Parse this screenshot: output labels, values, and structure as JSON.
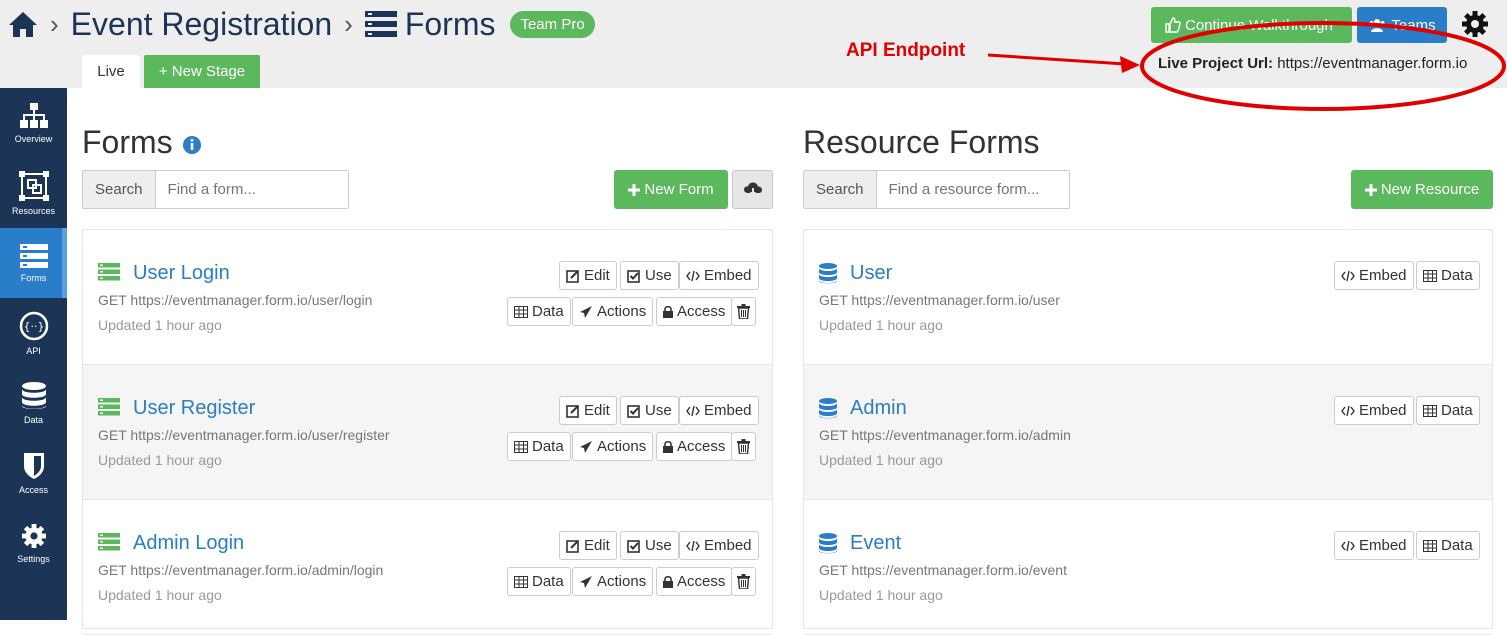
{
  "breadcrumb": {
    "project": "Event Registration",
    "section": "Forms",
    "badge": "Team Pro"
  },
  "stages": {
    "live": "Live",
    "new_stage": "+ New Stage"
  },
  "header_buttons": {
    "walkthrough": "Continue Walkthrough",
    "teams": "Teams"
  },
  "annotation": {
    "label": "API Endpoint",
    "color": "#e00000"
  },
  "live_url": {
    "label": "Live Project Url:",
    "value": "https://eventmanager.form.io"
  },
  "sidebar": {
    "items": [
      {
        "label": "Overview",
        "icon": "sitemap-icon"
      },
      {
        "label": "Resources",
        "icon": "resources-icon"
      },
      {
        "label": "Forms",
        "icon": "forms-icon",
        "active": true
      },
      {
        "label": "API",
        "icon": "api-icon"
      },
      {
        "label": "Data",
        "icon": "database-icon"
      },
      {
        "label": "Access",
        "icon": "shield-icon"
      },
      {
        "label": "Settings",
        "icon": "gear-icon"
      }
    ]
  },
  "forms": {
    "title": "Forms",
    "search_label": "Search",
    "search_placeholder": "Find a form...",
    "new_button": "New Form",
    "items": [
      {
        "name": "User Login",
        "url": "GET https://eventmanager.form.io/user/login",
        "updated": "Updated 1 hour ago"
      },
      {
        "name": "User Register",
        "url": "GET https://eventmanager.form.io/user/register",
        "updated": "Updated 1 hour ago"
      },
      {
        "name": "Admin Login",
        "url": "GET https://eventmanager.form.io/admin/login",
        "updated": "Updated 1 hour ago"
      }
    ],
    "actions": {
      "edit": "Edit",
      "use": "Use",
      "embed": "Embed",
      "data": "Data",
      "actions": "Actions",
      "access": "Access"
    }
  },
  "resources": {
    "title": "Resource Forms",
    "search_label": "Search",
    "search_placeholder": "Find a resource form...",
    "new_button": "New Resource",
    "items": [
      {
        "name": "User",
        "url": "GET https://eventmanager.form.io/user",
        "updated": "Updated 1 hour ago"
      },
      {
        "name": "Admin",
        "url": "GET https://eventmanager.form.io/admin",
        "updated": "Updated 1 hour ago"
      },
      {
        "name": "Event",
        "url": "GET https://eventmanager.form.io/event",
        "updated": "Updated 1 hour ago"
      }
    ],
    "actions": {
      "embed": "Embed",
      "data": "Data"
    }
  },
  "colors": {
    "navy": "#1c3557",
    "green": "#5cb85c",
    "blue": "#2a7dc9",
    "annotation_red": "#e00000"
  }
}
